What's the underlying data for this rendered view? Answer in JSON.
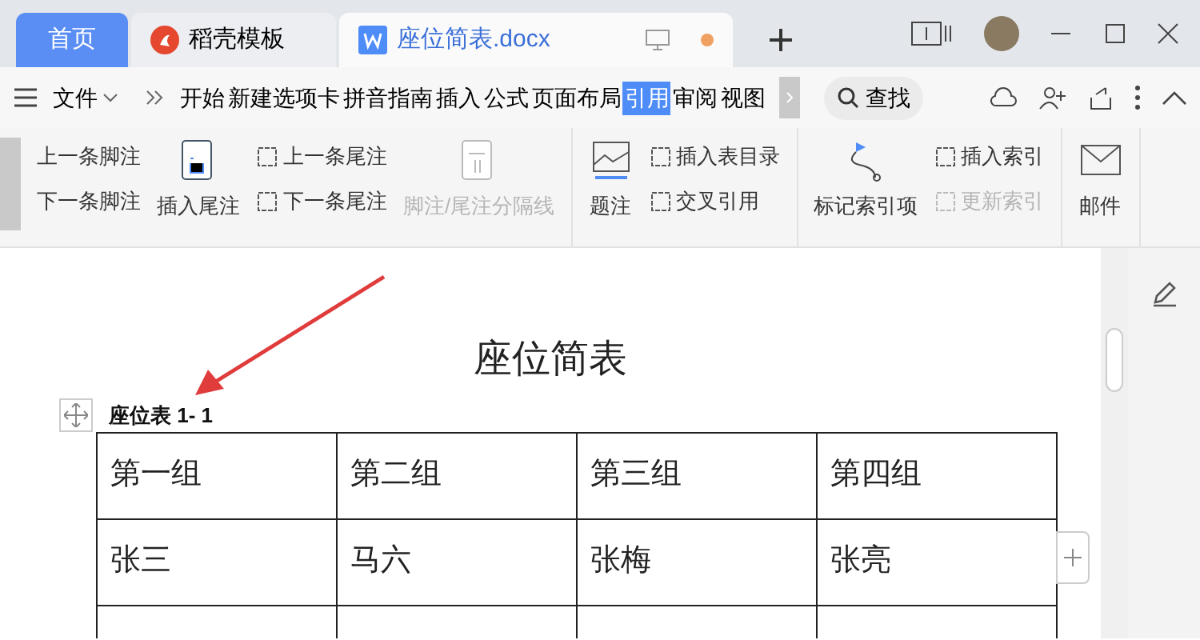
{
  "tabs": [
    {
      "label": "首页",
      "kind": "home",
      "selected": false
    },
    {
      "label": "稻壳模板",
      "kind": "template",
      "selected": false
    },
    {
      "label": "座位简表.docx",
      "kind": "doc",
      "selected": true,
      "unsaved": true
    }
  ],
  "toolbar": {
    "file_label": "文件",
    "search_label": "查找"
  },
  "ribbon_tabs": [
    {
      "label": "开始",
      "selected": false
    },
    {
      "label": "新建选项卡",
      "selected": false
    },
    {
      "label": "拼音指南",
      "selected": false
    },
    {
      "label": "插入",
      "selected": false
    },
    {
      "label": "公式",
      "selected": false
    },
    {
      "label": "页面布局",
      "selected": false
    },
    {
      "label": "引用",
      "selected": true
    },
    {
      "label": "审阅",
      "selected": false
    },
    {
      "label": "视图",
      "selected": false
    }
  ],
  "ribbon_groups": [
    [
      {
        "kind": "stack",
        "items": [
          {
            "label": "上一条脚注",
            "disabled": false
          },
          {
            "label": "下一条脚注",
            "disabled": false
          }
        ]
      },
      {
        "kind": "large",
        "label": "插入尾注",
        "disabled": false
      },
      {
        "kind": "stack",
        "items": [
          {
            "label": "上一条尾注",
            "disabled": false
          },
          {
            "label": "下一条尾注",
            "disabled": false
          }
        ]
      },
      {
        "kind": "large",
        "label": "脚注/尾注分隔线",
        "disabled": true
      }
    ],
    [
      {
        "kind": "large",
        "label": "题注",
        "disabled": false
      },
      {
        "kind": "stack",
        "items": [
          {
            "label": "插入表目录",
            "disabled": false
          },
          {
            "label": "交叉引用",
            "disabled": false
          }
        ]
      }
    ],
    [
      {
        "kind": "large",
        "label": "标记索引项",
        "disabled": false
      },
      {
        "kind": "stack",
        "items": [
          {
            "label": "插入索引",
            "disabled": false
          },
          {
            "label": "更新索引",
            "disabled": true
          }
        ]
      }
    ],
    [
      {
        "kind": "large",
        "label": "邮件",
        "disabled": false
      }
    ]
  ],
  "document": {
    "title": "座位简表",
    "caption": "座位表 1- 1",
    "table": {
      "rows": [
        [
          "第一组",
          "第二组",
          "第三组",
          "第四组"
        ],
        [
          "张三",
          "马六",
          "张梅",
          "张亮"
        ]
      ],
      "more_rows_below": true
    }
  }
}
